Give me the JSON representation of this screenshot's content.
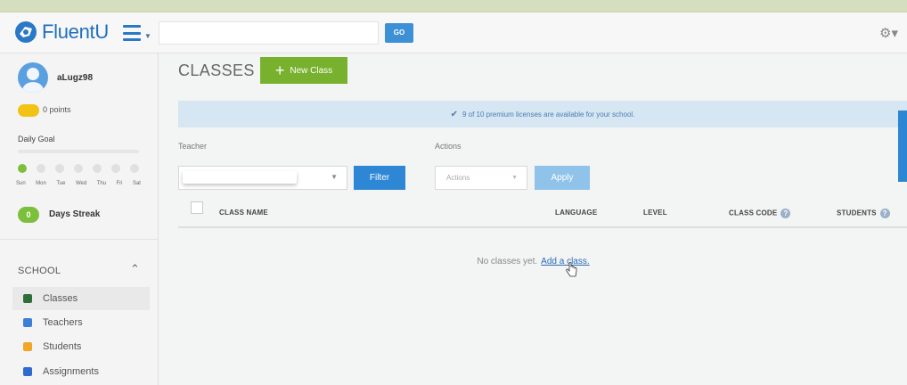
{
  "app": {
    "logo_text": "FluentU",
    "go_label": "GO",
    "colors": {
      "brand_blue": "#2a78c6",
      "green": "#78b12d",
      "filter_blue": "#2e87d5"
    }
  },
  "user": {
    "username": "aLugz98",
    "points": "0 points",
    "daily_goal_label": "Daily Goal",
    "goal_progress": 0,
    "days": [
      "Sun",
      "Mon",
      "Tue",
      "Wed",
      "Thu",
      "Fri",
      "Sat"
    ],
    "streak_count": "0",
    "streak_label": "Days Streak"
  },
  "sidebar": {
    "section_title": "SCHOOL",
    "items": [
      {
        "label": "Classes",
        "icon": "classes-icon",
        "active": true
      },
      {
        "label": "Teachers",
        "icon": "teachers-icon",
        "active": false
      },
      {
        "label": "Students",
        "icon": "students-icon",
        "active": false
      },
      {
        "label": "Assignments",
        "icon": "assignments-icon",
        "active": false
      }
    ]
  },
  "main": {
    "title": "CLASSES",
    "new_class_label": "New Class",
    "banner": "9 of 10 premium licenses are available for your school.",
    "teacher_label": "Teacher",
    "actions_label": "Actions",
    "teacher_value": "",
    "filter_label": "Filter",
    "actions_placeholder": "Actions",
    "apply_label": "Apply",
    "columns": {
      "class_name": "CLASS NAME",
      "language": "LANGUAGE",
      "level": "LEVEL",
      "class_code": "CLASS CODE",
      "students": "STUDENTS"
    },
    "empty_text": "No classes yet.",
    "empty_link": "Add a class."
  }
}
